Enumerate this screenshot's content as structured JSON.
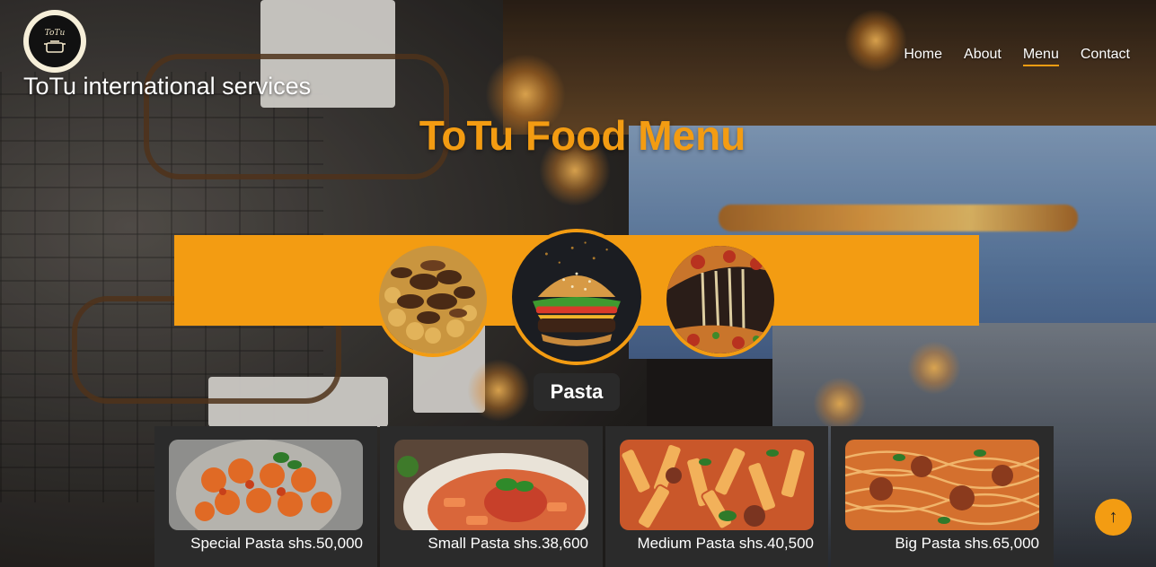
{
  "header": {
    "logo_text": "ToTu",
    "site_name": "ToTu international services"
  },
  "nav": {
    "items": [
      "Home",
      "About",
      "Menu",
      "Contact"
    ],
    "active": "Menu"
  },
  "page_title": "ToTu Food Menu",
  "categories": {
    "selected_label": "Pasta"
  },
  "products": [
    {
      "caption": "Special Pasta shs.50,000"
    },
    {
      "caption": "Small Pasta shs.38,600"
    },
    {
      "caption": "Medium Pasta shs.40,500"
    },
    {
      "caption": "Big Pasta shs.65,000"
    }
  ],
  "scroll_top": {
    "glyph": "↑"
  },
  "colors": {
    "accent": "#f39c12",
    "card_bg": "#2b2b2b",
    "text": "#ffffff"
  }
}
